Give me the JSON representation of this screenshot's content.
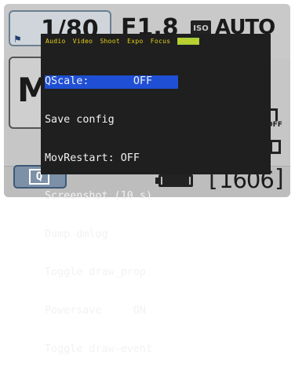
{
  "camera": {
    "shutter": "1/80",
    "aperture": "F1.8",
    "iso_label": "ISO",
    "iso_value": "AUTO",
    "mode": "M",
    "off_tag": "OFF",
    "quick_button": "Q",
    "shots_remaining": "1606",
    "bracket_left": "[",
    "bracket_right": "]"
  },
  "menu": {
    "tabs": [
      "Audio",
      "Video",
      "Shoot",
      "Expo",
      "Focus",
      "Debug"
    ],
    "active_tab": "Debug",
    "items": [
      "QScale:       OFF",
      "Save config",
      "MovRestart: OFF",
      "Screenshot (10 s)",
      "Dump dmlog",
      "Toggle draw_prop",
      "Powersave     ON",
      "Toggle draw-event"
    ],
    "selected_index": 0
  },
  "colors": {
    "menu_bg": "#1f1f1f",
    "tab_text": "#e8d11b",
    "active_tab_bg": "#a6cf3a",
    "selection": "#1f4fd4"
  }
}
